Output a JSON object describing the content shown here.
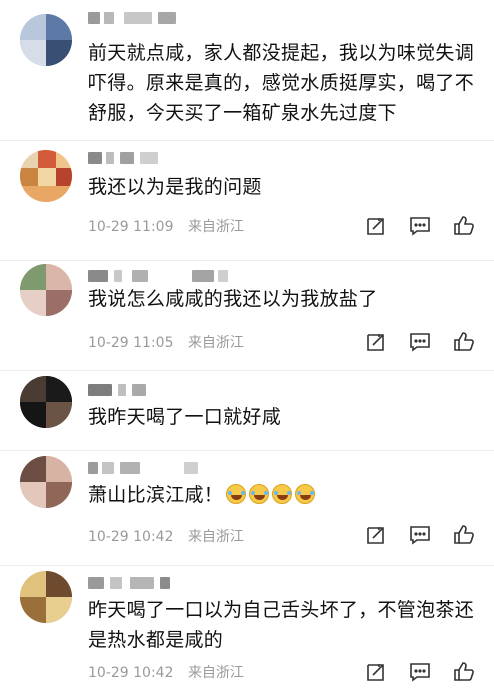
{
  "comments": [
    {
      "text": "前天就点咸，家人都没提起，我以为味觉失调吓得。原来是真的，感觉水质挺厚实，喝了不舒服，今天买了一箱矿泉水先过度下",
      "time": "",
      "location": ""
    },
    {
      "text": "我还以为是我的问题",
      "time": "10-29 11:09",
      "location": "来自浙江"
    },
    {
      "text": "我说怎么咸咸的我还以为我放盐了",
      "time": "10-29 11:05",
      "location": "来自浙江"
    },
    {
      "text": "我昨天喝了一口就好咸",
      "time": "",
      "location": ""
    },
    {
      "text": "萧山比滨江咸！",
      "time": "10-29 10:42",
      "location": "来自浙江",
      "emoji": "laughing-crying-emoji"
    },
    {
      "text": "昨天喝了一口以为自己舌头坏了，不管泡茶还是热水都是咸的",
      "time": "10-29 10:42",
      "location": "来自浙江"
    }
  ],
  "icons": {
    "repost": "repost-icon",
    "comment": "comment-icon",
    "like": "like-icon"
  },
  "colors": {
    "meta": "#9a9a9a",
    "icon": "#333333"
  }
}
